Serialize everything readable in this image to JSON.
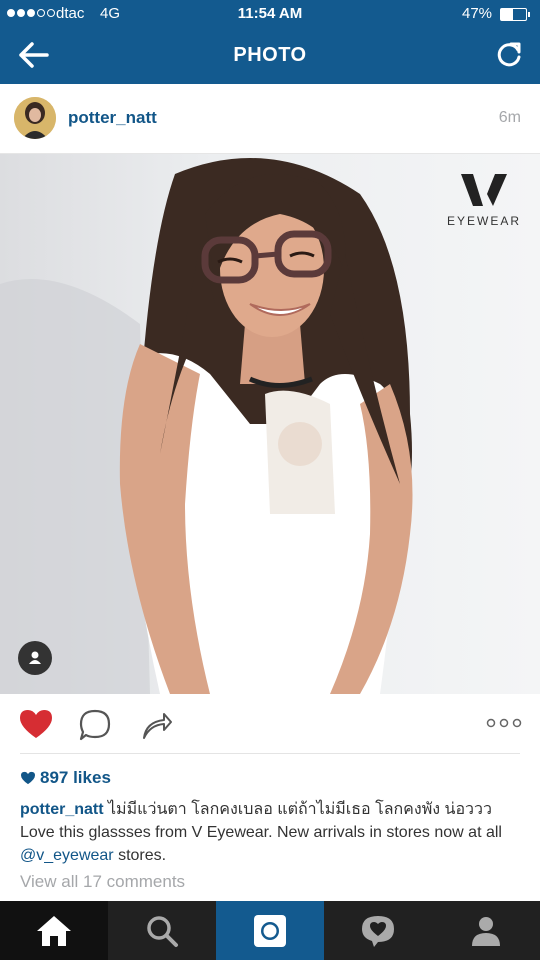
{
  "status_bar": {
    "carrier": "dtac",
    "network": "4G",
    "time": "11:54 AM",
    "battery_percent": "47%",
    "battery_level": 0.47,
    "signal_bars_filled": 3,
    "signal_bars_total": 5
  },
  "nav": {
    "title": "PHOTO",
    "back_icon": "arrow-left-icon",
    "refresh_icon": "refresh-icon"
  },
  "post": {
    "username": "potter_natt",
    "time_ago": "6m",
    "photo": {
      "brand_text": "EYEWEAR",
      "brand_logo": "V"
    },
    "likes_count": "897 likes",
    "caption": {
      "username": "potter_natt",
      "text_before": " ไม่มีแว่นตา โลกคงเบลอ แต่ถ้าไม่มีเธอ โลกคงพัง น่อววว  Love this glassses from V Eyewear. New arrivals in stores now at all ",
      "mention": "@v_eyewear",
      "text_after": " stores."
    },
    "view_all_comments": "View all 17 comments"
  },
  "colors": {
    "brand_blue": "#135a8f",
    "link_blue": "#125688",
    "heart_red": "#d62d33",
    "tab_bar": "#212121"
  },
  "tabs": [
    {
      "icon": "home-icon"
    },
    {
      "icon": "search-icon"
    },
    {
      "icon": "camera-icon"
    },
    {
      "icon": "activity-icon"
    },
    {
      "icon": "profile-icon"
    }
  ]
}
